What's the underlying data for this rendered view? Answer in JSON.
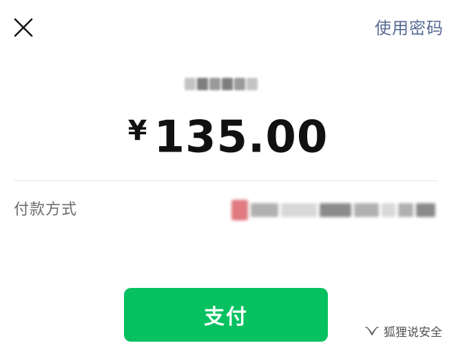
{
  "header": {
    "close_icon": "close-icon",
    "use_password_label": "使用密码"
  },
  "payment": {
    "currency_symbol": "¥",
    "amount": "135.00"
  },
  "method": {
    "label": "付款方式"
  },
  "pay_button_label": "支付",
  "watermark": {
    "icon": "wechat-channel-icon",
    "text": "狐狸说安全"
  },
  "colors": {
    "accent_green": "#07c160",
    "link_blue": "#576b95"
  }
}
